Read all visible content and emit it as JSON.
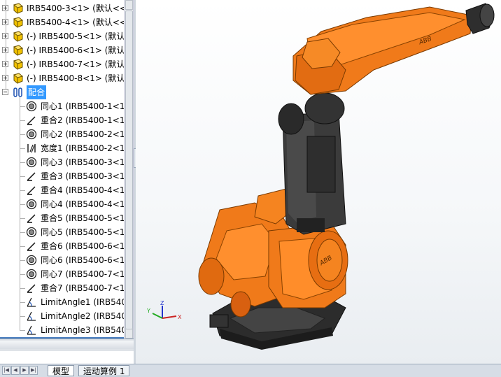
{
  "tree": {
    "components": [
      {
        "label": "IRB5400-3<1> (默认<<默"
      },
      {
        "label": "IRB5400-4<1> (默认<<默"
      },
      {
        "label": "(-) IRB5400-5<1> (默认<<"
      },
      {
        "label": "(-) IRB5400-6<1> (默认<<"
      },
      {
        "label": "(-) IRB5400-7<1> (默认<<"
      },
      {
        "label": "(-) IRB5400-8<1> (默认<<"
      }
    ],
    "mates_folder": "配合",
    "mates": [
      {
        "type": "concentric",
        "label": "同心1 (IRB5400-1<1"
      },
      {
        "type": "coincident",
        "label": "重合2 (IRB5400-1<1"
      },
      {
        "type": "concentric",
        "label": "同心2 (IRB5400-2<1"
      },
      {
        "type": "width",
        "label": "宽度1 (IRB5400-2<1"
      },
      {
        "type": "concentric",
        "label": "同心3 (IRB5400-3<1"
      },
      {
        "type": "coincident",
        "label": "重合3 (IRB5400-3<1"
      },
      {
        "type": "coincident",
        "label": "重合4 (IRB5400-4<1"
      },
      {
        "type": "concentric",
        "label": "同心4 (IRB5400-4<1"
      },
      {
        "type": "coincident",
        "label": "重合5 (IRB5400-5<1"
      },
      {
        "type": "concentric",
        "label": "同心5 (IRB5400-5<1"
      },
      {
        "type": "coincident",
        "label": "重合6 (IRB5400-6<1"
      },
      {
        "type": "concentric",
        "label": "同心6 (IRB5400-6<1"
      },
      {
        "type": "concentric",
        "label": "同心7 (IRB5400-7<1"
      },
      {
        "type": "coincident",
        "label": "重合7 (IRB5400-7<1"
      },
      {
        "type": "limitangle",
        "label": "LimitAngle1 (IRB5400"
      },
      {
        "type": "limitangle",
        "label": "LimitAngle2 (IRB5400"
      },
      {
        "type": "limitangle",
        "label": "LimitAngle3 (IRB5400"
      }
    ]
  },
  "tabs": [
    {
      "label": "模型",
      "active": true
    },
    {
      "label": "运动算例 1",
      "active": false
    }
  ],
  "triad": {
    "x": "X",
    "y": "Y",
    "z": "Z"
  },
  "robot_brand": "ABB",
  "colors": {
    "robot_orange": "#f07a1a",
    "robot_dark": "#3a3a3a",
    "selection": "#3399ff"
  }
}
